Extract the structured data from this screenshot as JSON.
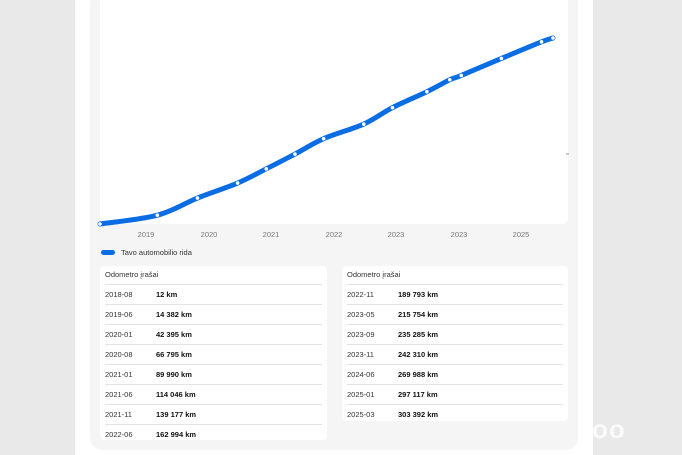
{
  "chart_data": {
    "type": "line",
    "title": "",
    "xlabel": "",
    "ylabel": "",
    "x_tick_labels": [
      "2019",
      "2020",
      "2021",
      "2022",
      "2023",
      "2023",
      "2025"
    ],
    "series": [
      {
        "name": "Tavo automobilio rida",
        "color": "#0a6de3",
        "x": [
          "2018-08",
          "2019-06",
          "2020-01",
          "2020-08",
          "2021-01",
          "2021-06",
          "2021-11",
          "2022-06",
          "2022-11",
          "2023-05",
          "2023-09",
          "2023-11",
          "2024-06",
          "2025-01",
          "2025-03"
        ],
        "values": [
          12,
          14382,
          42395,
          66795,
          89990,
          114046,
          139177,
          162994,
          189793,
          215754,
          235285,
          242310,
          269988,
          297117,
          303392
        ]
      }
    ],
    "grid": false,
    "legend_position": "bottom-left"
  },
  "legend": {
    "label": "Tavo automobilio rida"
  },
  "tables": {
    "left": {
      "title": "Odometro įrašai",
      "rows": [
        {
          "date": "2018-08",
          "km": "12 km"
        },
        {
          "date": "2019-06",
          "km": "14 382 km"
        },
        {
          "date": "2020-01",
          "km": "42 395 km"
        },
        {
          "date": "2020-08",
          "km": "66 795 km"
        },
        {
          "date": "2021-01",
          "km": "89 990 km"
        },
        {
          "date": "2021-06",
          "km": "114 046 km"
        },
        {
          "date": "2021-11",
          "km": "139 177 km"
        },
        {
          "date": "2022-06",
          "km": "162 994 km"
        }
      ]
    },
    "right": {
      "title": "Odometro įrašai",
      "rows": [
        {
          "date": "2022-11",
          "km": "189 793 km"
        },
        {
          "date": "2023-05",
          "km": "215 754 km"
        },
        {
          "date": "2023-09",
          "km": "235 285 km"
        },
        {
          "date": "2023-11",
          "km": "242 310 km"
        },
        {
          "date": "2024-06",
          "km": "269 988 km"
        },
        {
          "date": "2025-01",
          "km": "297 117 km"
        },
        {
          "date": "2025-03",
          "km": "303 392 km"
        }
      ]
    }
  },
  "watermark": {
    "text": "oo"
  }
}
